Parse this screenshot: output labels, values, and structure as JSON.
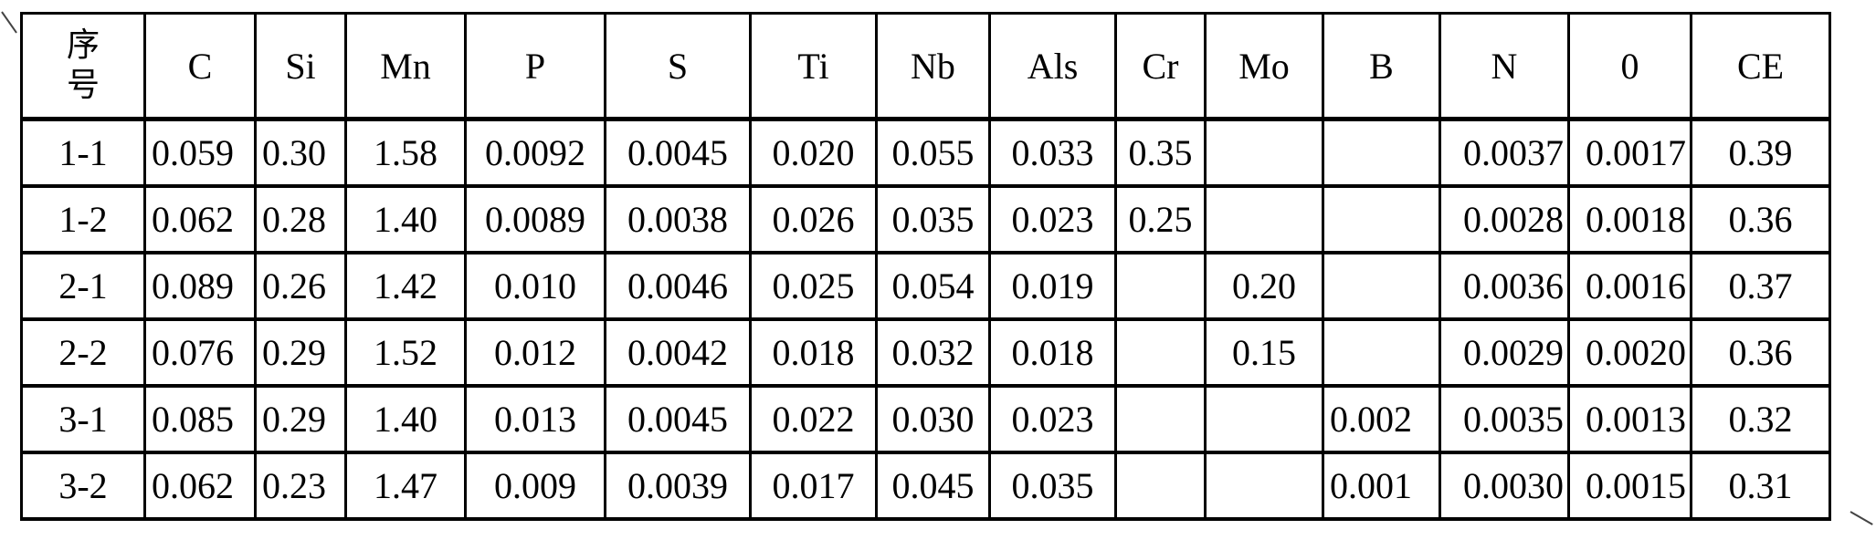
{
  "table": {
    "header_seq_line1": "序",
    "header_seq_line2": "号",
    "columns": [
      "C",
      "Si",
      "Mn",
      "P",
      "S",
      "Ti",
      "Nb",
      "Als",
      "Cr",
      "Mo",
      "B",
      "N",
      "0",
      "CE"
    ],
    "rows": [
      {
        "id": "1-1",
        "C": "0.059",
        "Si": "0.30",
        "Mn": "1.58",
        "P": "0.0092",
        "S": "0.0045",
        "Ti": "0.020",
        "Nb": "0.055",
        "Als": "0.033",
        "Cr": "0.35",
        "Mo": "",
        "B": "",
        "N": "0.0037",
        "O": "0.0017",
        "CE": "0.39"
      },
      {
        "id": "1-2",
        "C": "0.062",
        "Si": "0.28",
        "Mn": "1.40",
        "P": "0.0089",
        "S": "0.0038",
        "Ti": "0.026",
        "Nb": "0.035",
        "Als": "0.023",
        "Cr": "0.25",
        "Mo": "",
        "B": "",
        "N": "0.0028",
        "O": "0.0018",
        "CE": "0.36"
      },
      {
        "id": "2-1",
        "C": "0.089",
        "Si": "0.26",
        "Mn": "1.42",
        "P": "0.010",
        "S": "0.0046",
        "Ti": "0.025",
        "Nb": "0.054",
        "Als": "0.019",
        "Cr": "",
        "Mo": "0.20",
        "B": "",
        "N": "0.0036",
        "O": "0.0016",
        "CE": "0.37"
      },
      {
        "id": "2-2",
        "C": "0.076",
        "Si": "0.29",
        "Mn": "1.52",
        "P": "0.012",
        "S": "0.0042",
        "Ti": "0.018",
        "Nb": "0.032",
        "Als": "0.018",
        "Cr": "",
        "Mo": "0.15",
        "B": "",
        "N": "0.0029",
        "O": "0.0020",
        "CE": "0.36"
      },
      {
        "id": "3-1",
        "C": "0.085",
        "Si": "0.29",
        "Mn": "1.40",
        "P": "0.013",
        "S": "0.0045",
        "Ti": "0.022",
        "Nb": "0.030",
        "Als": "0.023",
        "Cr": "",
        "Mo": "",
        "B": "0.002",
        "N": "0.0035",
        "O": "0.0013",
        "CE": "0.32"
      },
      {
        "id": "3-2",
        "C": "0.062",
        "Si": "0.23",
        "Mn": "1.47",
        "P": "0.009",
        "S": "0.0039",
        "Ti": "0.017",
        "Nb": "0.045",
        "Als": "0.035",
        "Cr": "",
        "Mo": "",
        "B": "0.001",
        "N": "0.0030",
        "O": "0.0015",
        "CE": "0.31"
      }
    ]
  }
}
